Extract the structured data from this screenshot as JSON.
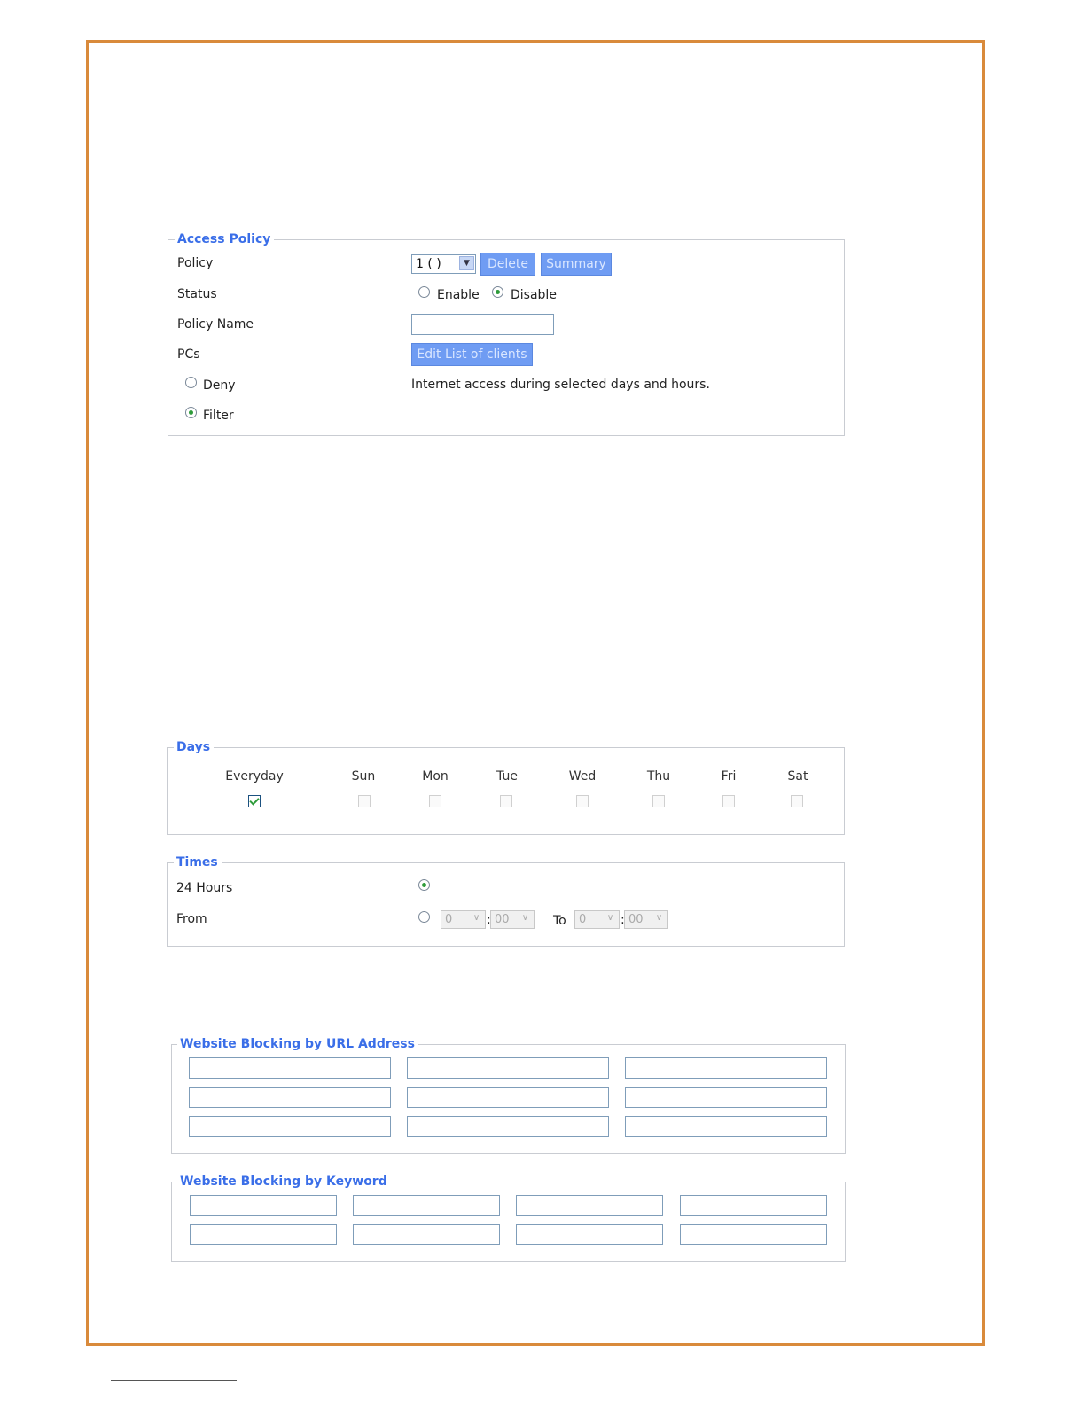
{
  "access_policy": {
    "legend": "Access Policy",
    "policy_label": "Policy",
    "policy_value": "1 ( )",
    "delete_label": "Delete",
    "summary_label": "Summary",
    "status_label": "Status",
    "status_options": [
      "Enable",
      "Disable"
    ],
    "status_selected": "Disable",
    "policy_name_label": "Policy Name",
    "policy_name_value": "",
    "pcs_label": "PCs",
    "edit_clients_label": "Edit List of clients",
    "deny_label": "Deny",
    "filter_label": "Filter",
    "mode_selected": "Filter",
    "access_note": "Internet access during selected days and hours."
  },
  "days": {
    "legend": "Days",
    "items": [
      {
        "label": "Everyday",
        "checked": true
      },
      {
        "label": "Sun",
        "checked": false
      },
      {
        "label": "Mon",
        "checked": false
      },
      {
        "label": "Tue",
        "checked": false
      },
      {
        "label": "Wed",
        "checked": false
      },
      {
        "label": "Thu",
        "checked": false
      },
      {
        "label": "Fri",
        "checked": false
      },
      {
        "label": "Sat",
        "checked": false
      }
    ]
  },
  "times": {
    "legend": "Times",
    "hours24_label": "24 Hours",
    "from_label": "From",
    "selected": "24 Hours",
    "from_hour": "0",
    "from_min": "00",
    "to_label": "To",
    "to_hour": "0",
    "to_min": "00",
    "separator": ":"
  },
  "url_blocking": {
    "legend": "Website Blocking by URL Address",
    "values": [
      "",
      "",
      "",
      "",
      "",
      "",
      "",
      "",
      ""
    ]
  },
  "keyword_blocking": {
    "legend": "Website Blocking by Keyword",
    "values": [
      "",
      "",
      "",
      "",
      "",
      "",
      "",
      ""
    ]
  }
}
